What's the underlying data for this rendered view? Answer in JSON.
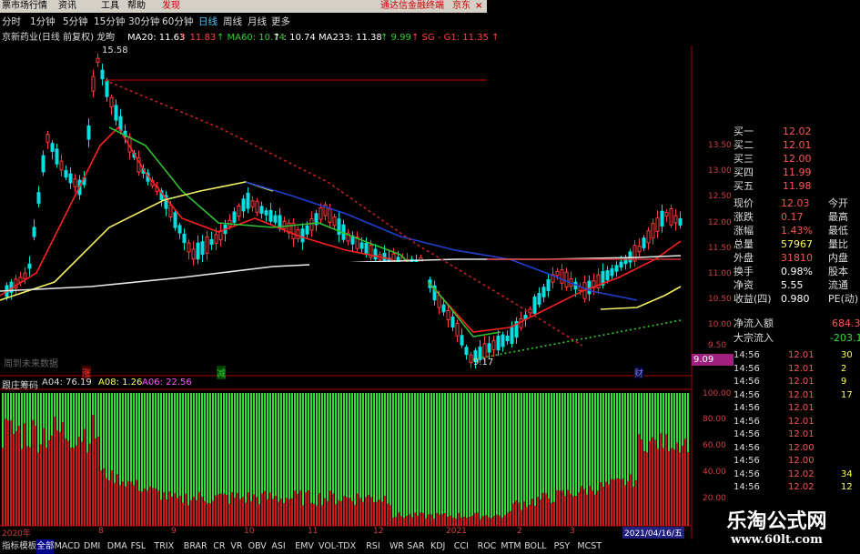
{
  "menubar": {
    "items": [
      "票市场行情",
      "资讯",
      "工具",
      "帮助"
    ],
    "discover": "发现",
    "promo": "通达信金融终端",
    "promo2": "京东",
    "close": "×"
  },
  "periods": [
    "分时",
    "1分钟",
    "5分钟",
    "15分钟",
    "30分钟",
    "60分钟",
    "日线",
    "周线",
    "月线",
    "更多"
  ],
  "active_period": "日线",
  "title": {
    "stock": "京新药业(日线 前复权) 龙昫",
    "ma20": "MA20: 11.63",
    "ma20b": "↑ 11.83",
    "ma60": "↑ MA60: 10.74",
    "ma60b": "↑ : 10.74",
    "ma233": "MA233: 11.38",
    "ma233b": "↑ 9.99",
    "extra": "↑ SG - G1: 11.35 ↑"
  },
  "chart_data": {
    "type": "candlestick",
    "high_label": "15.58",
    "low_label": "9.17",
    "price_axis": [
      "12.50",
      "12.00",
      "11.50",
      "11.00",
      "10.50",
      "10.00",
      "9.50"
    ],
    "price_axis_upper": [
      "13.50",
      "13.00"
    ],
    "current_price_box": "9.09",
    "markers": {
      "zhang": "涨",
      "jian": "减",
      "cai": "财"
    },
    "future_label": "周到未来数据",
    "x_ticks": [
      "2020年",
      "8",
      "9",
      "10",
      "11",
      "12",
      "2021",
      "2",
      "3",
      "4"
    ],
    "date_label": "2021/04/16/五",
    "indicator": {
      "name": "跟庄筹码",
      "a04": "A04: 76.19",
      "a08": "A08: 1.26",
      "a06": "A06: 22.56",
      "axis": [
        "100.00",
        "80.00",
        "60.00",
        "40.00",
        "20.00"
      ]
    }
  },
  "quote": {
    "bid": [
      {
        "label": "买一",
        "price": "12.02"
      },
      {
        "label": "买二",
        "price": "12.01"
      },
      {
        "label": "买三",
        "price": "12.00"
      },
      {
        "label": "买四",
        "price": "11.99"
      },
      {
        "label": "买五",
        "price": "11.98"
      }
    ],
    "stats": [
      {
        "l1": "现价",
        "v1": "12.03",
        "l2": "今开",
        "v1_color": "#ff5555"
      },
      {
        "l1": "涨跌",
        "v1": "0.17",
        "l2": "最高",
        "v1_color": "#ff5555"
      },
      {
        "l1": "涨幅",
        "v1": "1.43%",
        "l2": "最低",
        "v1_color": "#ff5555"
      },
      {
        "l1": "总量",
        "v1": "57967",
        "l2": "量比",
        "v1_color": "#ffff55"
      },
      {
        "l1": "外盘",
        "v1": "31810",
        "l2": "内盘",
        "v1_color": "#ff5555"
      },
      {
        "l1": "换手",
        "v1": "0.98%",
        "l2": "股本",
        "v1_color": "#ffffff"
      },
      {
        "l1": "净资",
        "v1": "5.55",
        "l2": "流通",
        "v1_color": "#ffffff"
      },
      {
        "l1": "收益(四)",
        "v1": "0.980",
        "l2": "PE(动)",
        "v1_color": "#ffffff"
      }
    ],
    "netflow": {
      "label": "净流入额",
      "value": "684.3"
    },
    "bigflow": {
      "label": "大宗流入",
      "value": "-203.1"
    }
  },
  "ticks": [
    {
      "time": "14:56",
      "price": "12.01",
      "vol": "30"
    },
    {
      "time": "14:56",
      "price": "12.01",
      "vol": "2"
    },
    {
      "time": "14:56",
      "price": "12.01",
      "vol": "9"
    },
    {
      "time": "14:56",
      "price": "12.01",
      "vol": "17"
    },
    {
      "time": "14:56",
      "price": "12.01",
      "vol": ""
    },
    {
      "time": "14:56",
      "price": "12.01",
      "vol": ""
    },
    {
      "time": "14:56",
      "price": "12.01",
      "vol": ""
    },
    {
      "time": "14:56",
      "price": "12.00",
      "vol": ""
    },
    {
      "time": "14:56",
      "price": "12.00",
      "vol": ""
    },
    {
      "time": "14:56",
      "price": "12.02",
      "vol": "34"
    },
    {
      "time": "14:56",
      "price": "12.02",
      "vol": "12"
    }
  ],
  "bottom_tabs": [
    "指标",
    "模板",
    "全部",
    "MACD",
    "DMI",
    "DMA",
    "FSL",
    "TRIX",
    "BRAR",
    "CR",
    "VR",
    "OBV",
    "ASI",
    "EMV",
    "VOL-TDX",
    "RSI",
    "WR",
    "SAR",
    "KDJ",
    "CCI",
    "ROC",
    "MTM",
    "BOLL",
    "PSY",
    "MCST"
  ],
  "watermark": {
    "title": "乐淘公式网",
    "url": "www.60lt.com"
  },
  "colors": {
    "up": "#ff3b3b",
    "down": "#00e0e0",
    "ma20": "#ff2020",
    "ma60": "#30c030",
    "ma233": "#e8e8e8",
    "yellow": "#f0f060",
    "blue": "#2040d0",
    "green_bar": "#33dd33",
    "red_bar": "#cc1a1a"
  }
}
